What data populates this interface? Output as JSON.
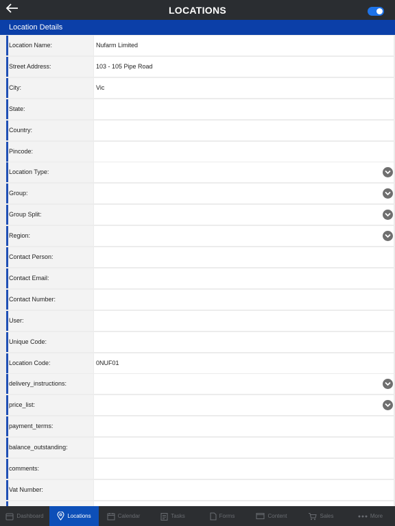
{
  "header": {
    "title": "LOCATIONS"
  },
  "section": {
    "title": "Location Details"
  },
  "fields": [
    {
      "label": "Location Name:",
      "value": "Nufarm Limited",
      "dropdown": false
    },
    {
      "label": "Street Address:",
      "value": "103 - 105 Pipe Road",
      "dropdown": false
    },
    {
      "label": "City:",
      "value": "Vic",
      "dropdown": false
    },
    {
      "label": "State:",
      "value": "",
      "dropdown": false
    },
    {
      "label": "Country:",
      "value": "",
      "dropdown": false
    },
    {
      "label": "Pincode:",
      "value": "",
      "dropdown": false
    },
    {
      "label": "Location Type:",
      "value": "",
      "dropdown": true
    },
    {
      "label": "Group:",
      "value": "",
      "dropdown": true
    },
    {
      "label": "Group Split:",
      "value": "",
      "dropdown": true
    },
    {
      "label": "Region:",
      "value": "",
      "dropdown": true
    },
    {
      "label": "Contact Person:",
      "value": "",
      "dropdown": false
    },
    {
      "label": "Contact Email:",
      "value": "",
      "dropdown": false
    },
    {
      "label": "Contact Number:",
      "value": "",
      "dropdown": false
    },
    {
      "label": "User:",
      "value": "",
      "dropdown": false
    },
    {
      "label": "Unique Code:",
      "value": "",
      "dropdown": false
    },
    {
      "label": "Location Code:",
      "value": "0NUF01",
      "dropdown": false
    },
    {
      "label": "delivery_instructions:",
      "value": "",
      "dropdown": true
    },
    {
      "label": "price_list:",
      "value": "",
      "dropdown": true
    },
    {
      "label": "payment_terms:",
      "value": "",
      "dropdown": false
    },
    {
      "label": "balance_outstanding:",
      "value": "",
      "dropdown": false
    },
    {
      "label": "comments:",
      "value": "",
      "dropdown": false
    },
    {
      "label": "Vat Number:",
      "value": "",
      "dropdown": false
    },
    {
      "label": "",
      "value": "",
      "dropdown": false
    }
  ],
  "tabs": [
    {
      "label": "Dashboard",
      "icon": "dashboard-icon",
      "active": false
    },
    {
      "label": "Locations",
      "icon": "location-pin-icon",
      "active": true
    },
    {
      "label": "Calendar",
      "icon": "calendar-icon",
      "active": false
    },
    {
      "label": "Tasks",
      "icon": "tasks-icon",
      "active": false
    },
    {
      "label": "Forms",
      "icon": "forms-icon",
      "active": false
    },
    {
      "label": "Content",
      "icon": "content-icon",
      "active": false
    },
    {
      "label": "Sales",
      "icon": "cart-icon",
      "active": false
    },
    {
      "label": "More",
      "icon": "more-icon",
      "active": false
    }
  ],
  "colors": {
    "header_bg": "#2a2d31",
    "section_bg": "#0b3fa8",
    "accent": "#1f4fb5",
    "active_tab": "#0d4fb8",
    "toggle": "#1e73e8"
  }
}
